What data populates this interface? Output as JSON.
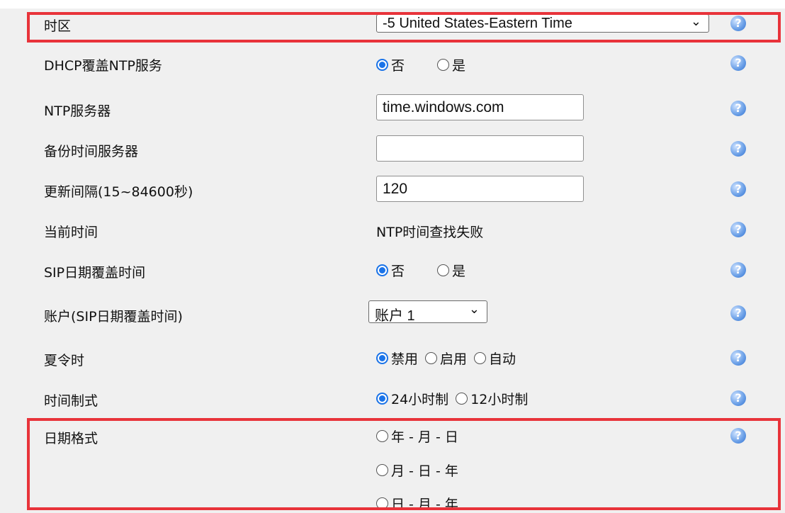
{
  "rows": {
    "timezone": {
      "label": "时区",
      "value": "-5 United States-Eastern Time"
    },
    "dhcp_ntp": {
      "label": "DHCP覆盖NTP服务",
      "options": [
        "否",
        "是"
      ],
      "selected": 0
    },
    "ntp_server": {
      "label": "NTP服务器",
      "value": "time.windows.com"
    },
    "backup_server": {
      "label": "备份时间服务器",
      "value": ""
    },
    "update_interval": {
      "label": "更新间隔(15~84600秒)",
      "value": "120"
    },
    "current_time": {
      "label": "当前时间",
      "value": "NTP时间查找失败"
    },
    "sip_date": {
      "label": "SIP日期覆盖时间",
      "options": [
        "否",
        "是"
      ],
      "selected": 0
    },
    "sip_account": {
      "label": "账户(SIP日期覆盖时间)",
      "value": "账户 1"
    },
    "dst": {
      "label": "夏令时",
      "options": [
        "禁用",
        "启用",
        "自动"
      ],
      "selected": 0
    },
    "time_format": {
      "label": "时间制式",
      "options": [
        "24小时制",
        "12小时制"
      ],
      "selected": 0
    },
    "date_format": {
      "label": "日期格式",
      "options": [
        "年 - 月 - 日",
        "月 - 日 - 年",
        "日 - 月 - 年"
      ],
      "selected": null
    }
  },
  "help_icon": "help-question-icon",
  "colors": {
    "accent": "#1a73e8",
    "highlight": "#e8333a",
    "background": "#f0f0f0"
  }
}
